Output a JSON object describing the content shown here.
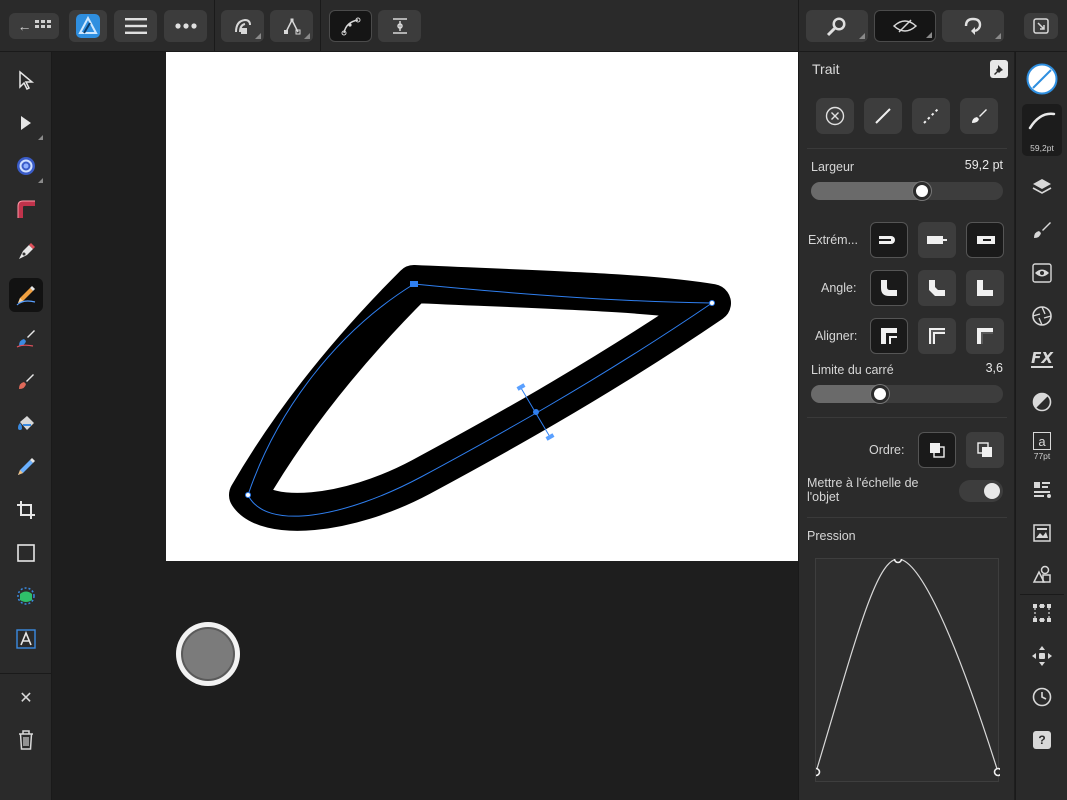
{
  "toolbar": {
    "back_label": "←",
    "personas": [
      "designer-persona",
      "pixel-persona"
    ],
    "items": [
      "back-to-gallery",
      "affinity-designer-logo",
      "menu",
      "more",
      "snapping",
      "node-tools",
      "curve-edit",
      "transform-origin"
    ]
  },
  "tools": [
    {
      "name": "move-tool",
      "icon": "cursor-arrow-icon"
    },
    {
      "name": "node-tool",
      "icon": "node-arrow-icon"
    },
    {
      "name": "contour-tool",
      "icon": "contour-icon"
    },
    {
      "name": "corner-tool",
      "icon": "corner-icon"
    },
    {
      "name": "pen-tool",
      "icon": "pen-icon"
    },
    {
      "name": "pencil-tool",
      "icon": "pencil-icon"
    },
    {
      "name": "vector-brush-tool",
      "icon": "brush-icon"
    },
    {
      "name": "paint-brush-tool",
      "icon": "paint-icon"
    },
    {
      "name": "fill-tool",
      "icon": "bucket-icon"
    },
    {
      "name": "transparency-tool",
      "icon": "gradient-pen-icon"
    },
    {
      "name": "crop-tool",
      "icon": "crop-icon"
    },
    {
      "name": "rectangle-tool",
      "icon": "square-icon"
    },
    {
      "name": "shape-tool",
      "icon": "shape-icon"
    },
    {
      "name": "text-tool",
      "icon": "text-frame-icon"
    }
  ],
  "left_bottom": {
    "close": "✕",
    "delete": "trash-icon"
  },
  "panel": {
    "title": "Trait",
    "width_label": "Largeur",
    "width_value": "59,2 pt",
    "width_fraction": 0.58,
    "ends_label": "Extrém...",
    "angle_label": "Angle:",
    "align_label": "Aligner:",
    "miter_label": "Limite du carré",
    "miter_value": "3,6",
    "miter_fraction": 0.36,
    "order_label": "Ordre:",
    "scale_label": "Mettre à l'échelle de l'objet",
    "scale_enabled": true,
    "pressure_label": "Pression"
  },
  "strip": {
    "stroke_size": "59,2pt",
    "text_size": "77pt",
    "text_glyph": "a",
    "fx_label": "FX",
    "help_label": "?"
  },
  "colors": {
    "accent": "#2f8fe0",
    "panel_bg": "#2b2b2b",
    "path_color": "#000000"
  }
}
